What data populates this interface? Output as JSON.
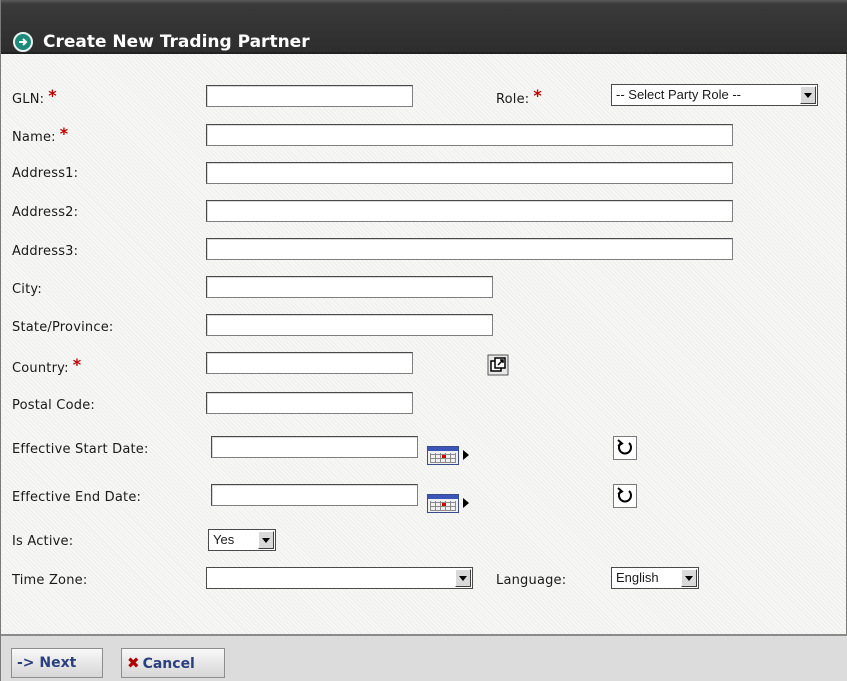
{
  "window": {
    "title": "Create New Trading Partner"
  },
  "form": {
    "gln_label": "GLN:",
    "role_label": "Role:",
    "role_value": "-- Select Party Role --",
    "name_label": "Name:",
    "address1_label": "Address1:",
    "address2_label": "Address2:",
    "address3_label": "Address3:",
    "city_label": "City:",
    "state_label": "State/Province:",
    "country_label": "Country:",
    "postal_label": "Postal Code:",
    "start_date_label": "Effective Start Date:",
    "end_date_label": "Effective End Date:",
    "is_active_label": "Is Active:",
    "is_active_value": "Yes",
    "time_zone_label": "Time Zone:",
    "time_zone_value": "",
    "language_label": "Language:",
    "language_value": "English",
    "required_marker": "*"
  },
  "icons": {
    "title": "arrow-circle-icon",
    "country_lookup": "lookup-popup-icon",
    "calendar": "calendar-icon",
    "reset": "reset-icon"
  },
  "footer": {
    "next_label": "-> Next",
    "cancel_label": "Cancel",
    "cancel_glyph": "✖"
  },
  "colors": {
    "title_bar": "#333333",
    "required": "#c00000",
    "button_text": "#2a3f7e",
    "title_icon": "#1f8a7a"
  }
}
